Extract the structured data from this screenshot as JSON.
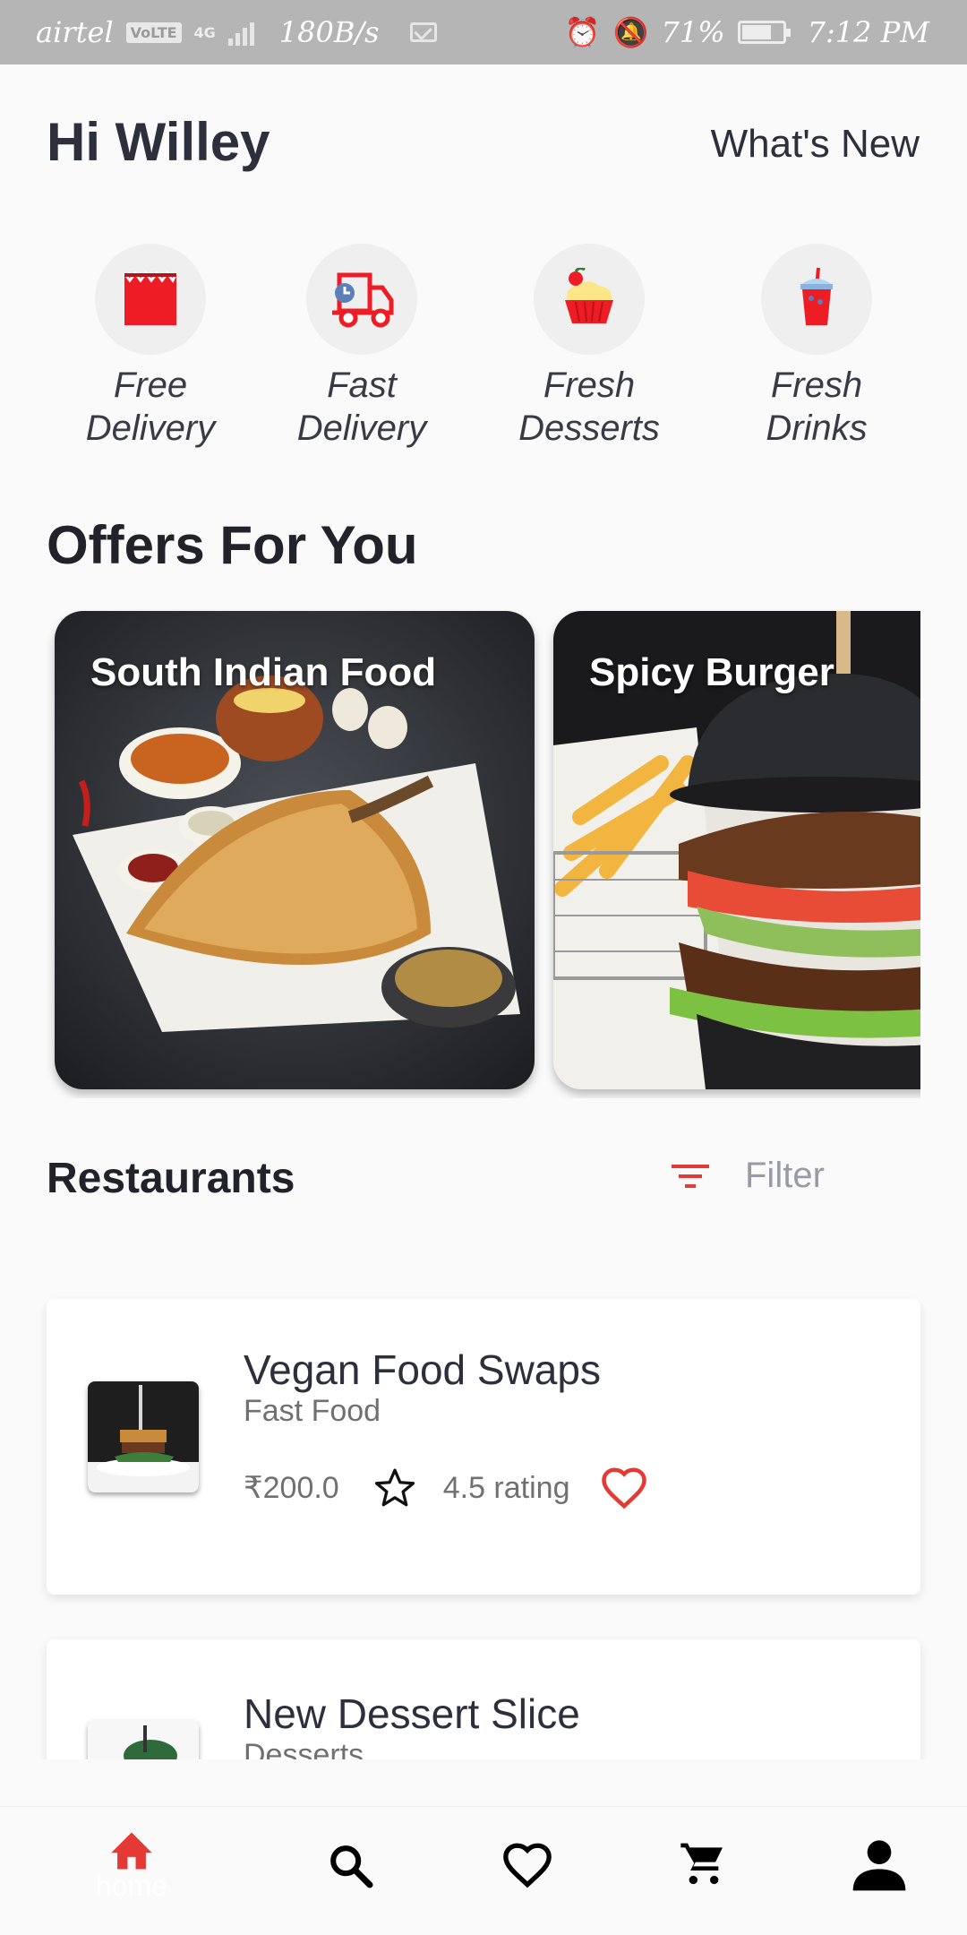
{
  "status_bar": {
    "carrier": "airtel",
    "volte_badge": "VoLTE",
    "network": "4G",
    "speed": "180B/s",
    "battery": "71%",
    "time": "7:12 PM"
  },
  "header": {
    "greeting": "Hi Willey",
    "whats_new": "What's New"
  },
  "categories": [
    {
      "line1": "Free",
      "line2": "Delivery",
      "icon": "shopping-bag-icon"
    },
    {
      "line1": "Fast",
      "line2": "Delivery",
      "icon": "delivery-truck-icon"
    },
    {
      "line1": "Fresh",
      "line2": "Desserts",
      "icon": "cupcake-icon"
    },
    {
      "line1": "Fresh",
      "line2": "Drinks",
      "icon": "drink-cup-icon"
    }
  ],
  "offers": {
    "title": "Offers For You",
    "items": [
      {
        "title": "South Indian Food"
      },
      {
        "title": "Spicy Burger"
      }
    ]
  },
  "restaurants": {
    "title": "Restaurants",
    "filter_label": "Filter",
    "items": [
      {
        "name": "Vegan Food Swaps",
        "category": "Fast Food",
        "price": "₹200.0",
        "rating": "4.5 rating"
      },
      {
        "name": "New Dessert Slice",
        "category": "Desserts"
      }
    ]
  },
  "nav": {
    "home_label": "home",
    "active": "home"
  },
  "colors": {
    "accent": "#e53935",
    "text_dark": "#2e2f3c",
    "text_muted": "#707070",
    "status_bar": "#b5b5b5"
  }
}
